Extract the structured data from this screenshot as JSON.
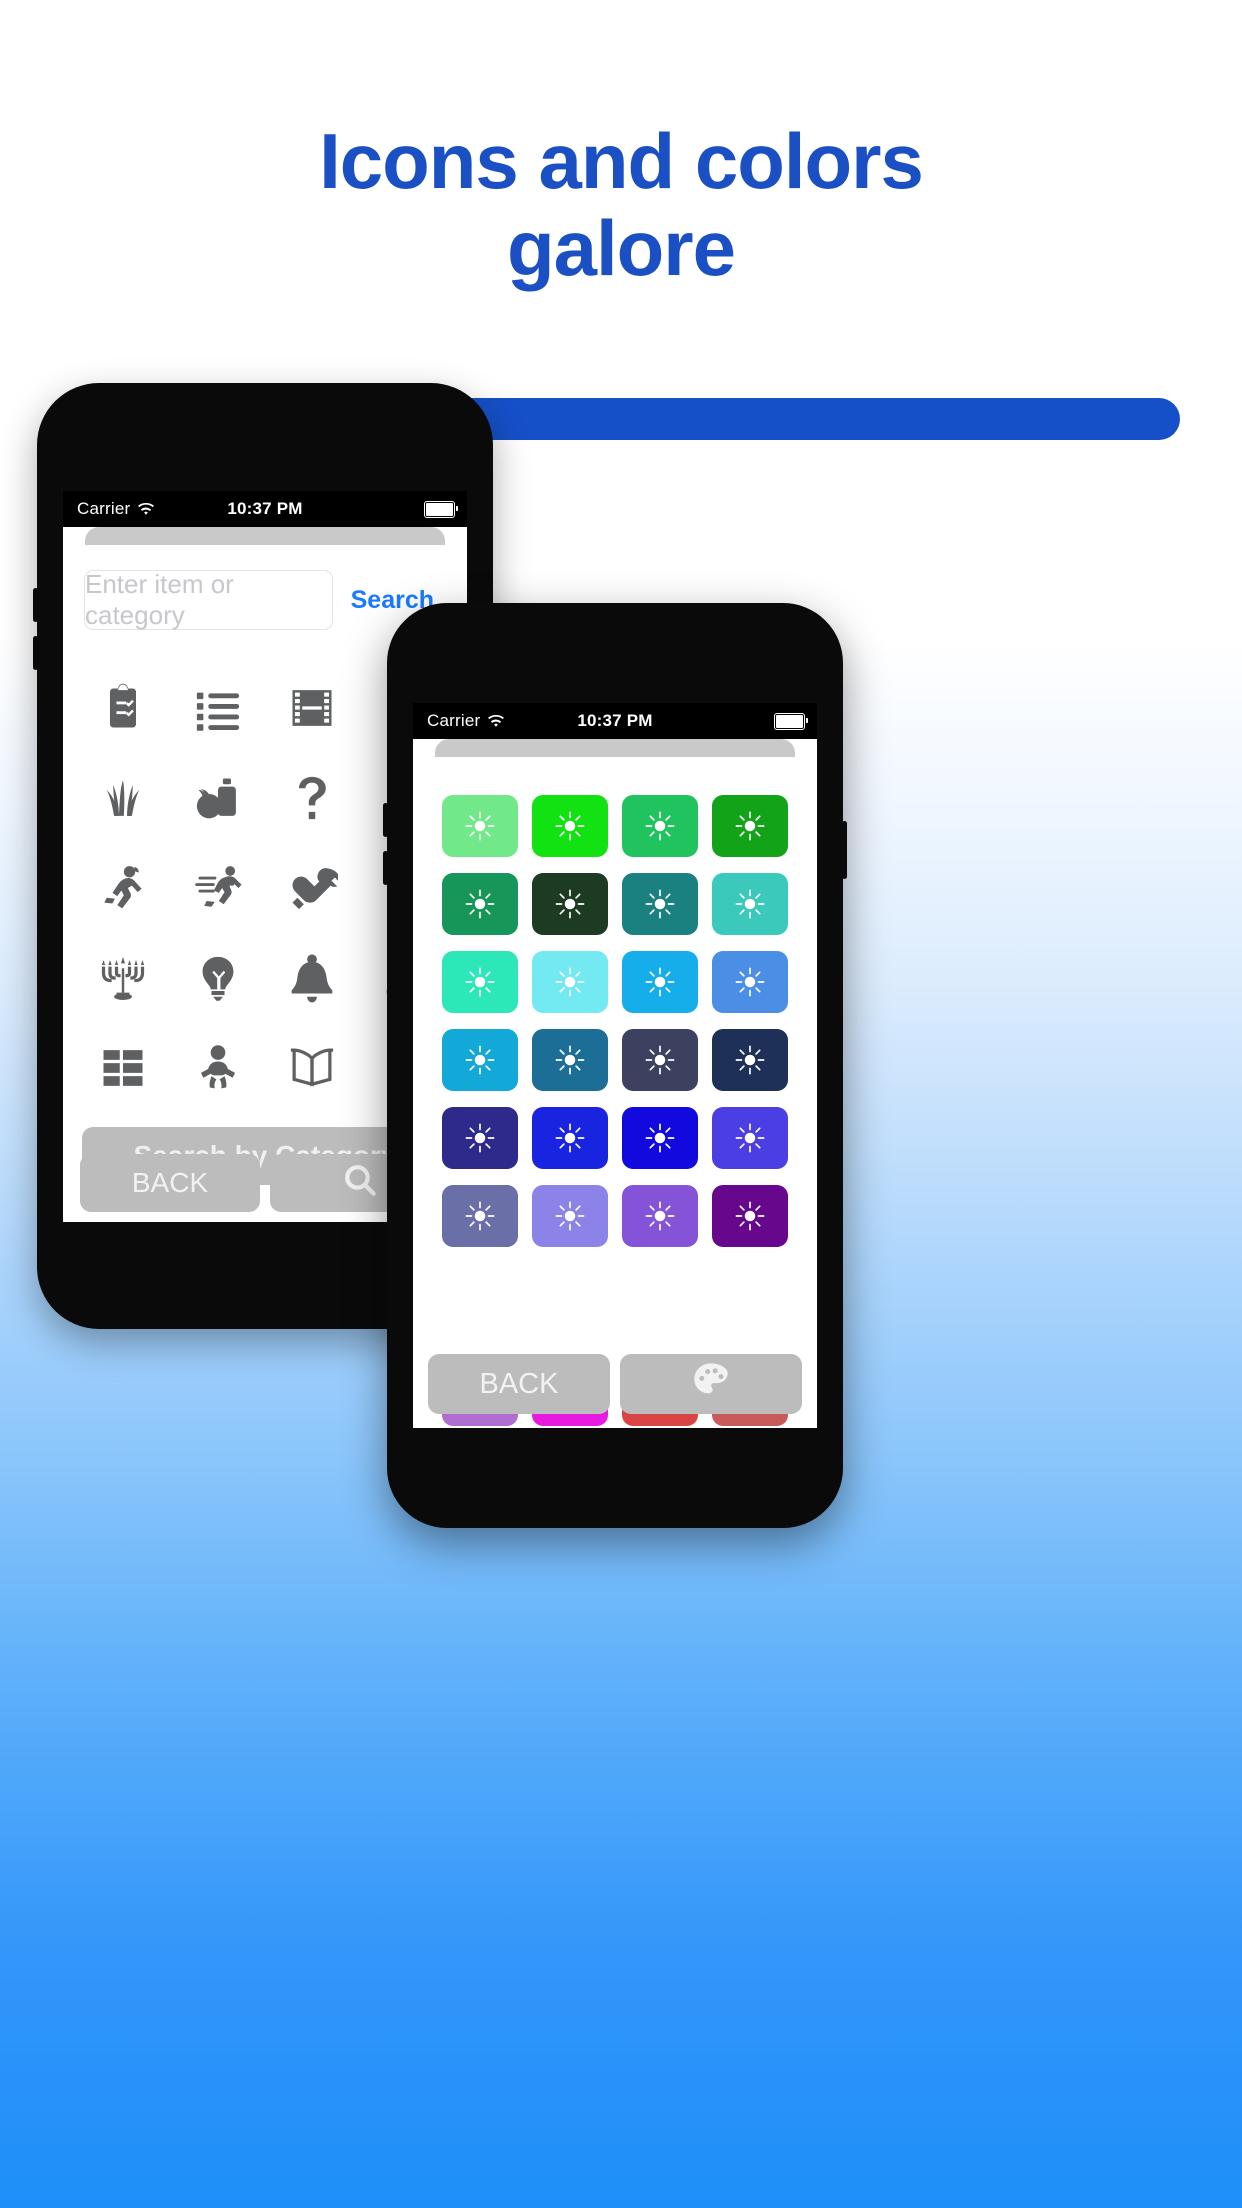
{
  "hero": {
    "title_line1": "Icons and colors",
    "title_line2": "galore",
    "title_color": "#1b4fc4",
    "pill_color": "#1650c8",
    "pill_label": ""
  },
  "phone_back": {
    "status": {
      "carrier": "Carrier",
      "wifi_icon": "wifi-icon",
      "time": "10:37 PM",
      "battery_icon": "battery-full-icon"
    },
    "search": {
      "placeholder": "Enter item or category",
      "value": "",
      "search_link": "Search",
      "link_color": "#1a7bff"
    },
    "icon_grid": {
      "columns": 4,
      "icons": [
        "clipboard-check-icon",
        "list-bullets-icon",
        "film-strip-icon",
        "cut-partial-icon",
        "grass-icon",
        "groceries-icon",
        "question-mark-icon",
        "dots-partial-icon",
        "running-woman-icon",
        "running-man-fast-icon",
        "fist-wrench-icon",
        "person-partial-icon",
        "menorah-icon",
        "lightbulb-icon",
        "bell-icon",
        "bell-partial-icon",
        "grid-table-icon",
        "baby-icon",
        "open-book-icon",
        "number-partial-icon"
      ]
    },
    "category_button": "Search by Category",
    "bottom_buttons": [
      {
        "label": "BACK",
        "icon": ""
      },
      {
        "label": "",
        "icon": "magnifier-icon"
      }
    ]
  },
  "phone_front": {
    "status": {
      "carrier": "Carrier",
      "wifi_icon": "wifi-icon",
      "time": "10:37 PM",
      "battery_icon": "battery-full-icon"
    },
    "color_grid": {
      "columns": 4,
      "tile_icon": "brightness-sun-icon",
      "tile_icon_color": "#ffffff",
      "rows": [
        [
          "#71e98a",
          "#12e212",
          "#20c35d",
          "#12a318"
        ],
        [
          "#17965a",
          "#1d3b23",
          "#1b8080",
          "#3ac9ba"
        ],
        [
          "#2ce8b8",
          "#73eaf2",
          "#16aeea",
          "#4a8ee6"
        ],
        [
          "#12a8d8",
          "#1d6e96",
          "#3c4160",
          "#1e2f58"
        ],
        [
          "#2e2a8c",
          "#1924e0",
          "#1109dd",
          "#4b3ee2"
        ],
        [
          "#6a6fa8",
          "#8c83e8",
          "#8453d8",
          "#67078b"
        ]
      ],
      "peek_row": [
        "#b06fd0",
        "#e81ae0",
        "#d94545",
        "#c85a5a"
      ]
    },
    "bottom_buttons": [
      {
        "label": "BACK",
        "icon": ""
      },
      {
        "label": "",
        "icon": "palette-icon"
      }
    ]
  }
}
